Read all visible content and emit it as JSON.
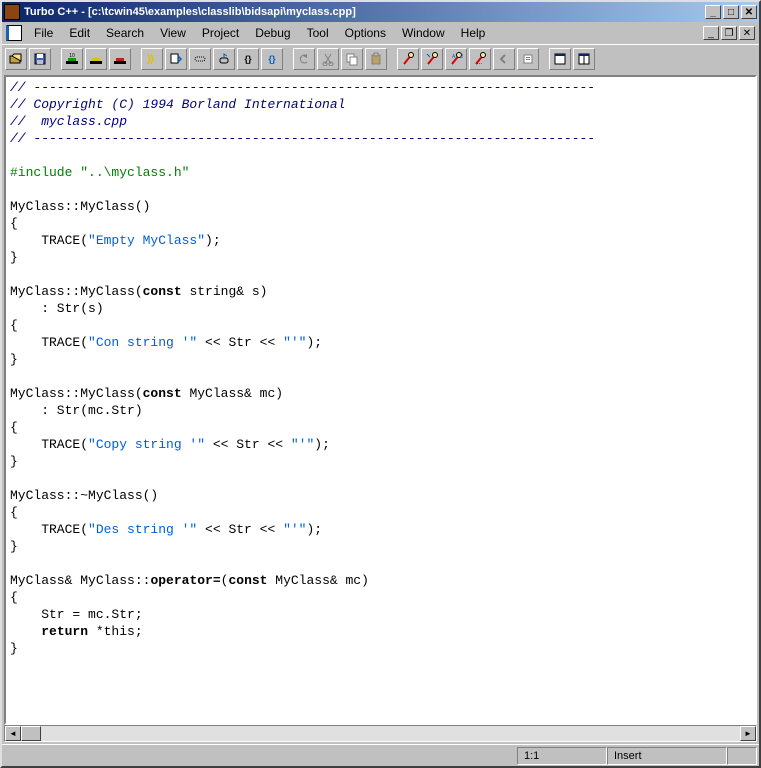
{
  "titlebar": {
    "app": "Turbo C++",
    "doc_path": "[c:\\tcwin45\\examples\\classlib\\bidsapi\\myclass.cpp]"
  },
  "menu": {
    "file": "File",
    "edit": "Edit",
    "search": "Search",
    "view": "View",
    "project": "Project",
    "debug": "Debug",
    "tool": "Tool",
    "options": "Options",
    "window": "Window",
    "help": "Help"
  },
  "status": {
    "cursor": "1:1",
    "mode": "Insert"
  },
  "code": {
    "dash1": "// ------------------------------------------------------------------------",
    "copyright": "// Copyright (C) 1994 Borland International",
    "filename": "//  myclass.cpp",
    "dash2": "// ------------------------------------------------------------------------",
    "include": "#include \"..\\myclass.h\"",
    "ctor0_sig": "MyClass::MyClass()",
    "brace_open": "{",
    "brace_close": "}",
    "trace_empty_pre": "    TRACE(",
    "trace_empty_str": "\"Empty MyClass\"",
    "trace_tail_semi": ");",
    "ctor1_sig_pre": "MyClass::MyClass(",
    "ctor1_kw": "const",
    "ctor1_sig_post": " string& s)",
    "ctor1_init": "    : Str(s)",
    "trace_con_str": "\"Con string '\"",
    "trace_mid_stream": " << Str << ",
    "trace_end_str": "\"'\"",
    "ctor2_sig_post": " MyClass& mc)",
    "ctor2_init": "    : Str(mc.Str)",
    "trace_copy_str": "\"Copy string '\"",
    "dtor_sig": "MyClass::~MyClass()",
    "trace_des_str": "\"Des string '\"",
    "opeq_pre": "MyClass& MyClass::",
    "opeq_kw": "operator=",
    "opeq_paren": "(",
    "opeq_assign": "    Str = mc.Str;",
    "opeq_ret_pre": "    ",
    "opeq_ret_kw": "return",
    "opeq_ret_post": " *this;"
  }
}
